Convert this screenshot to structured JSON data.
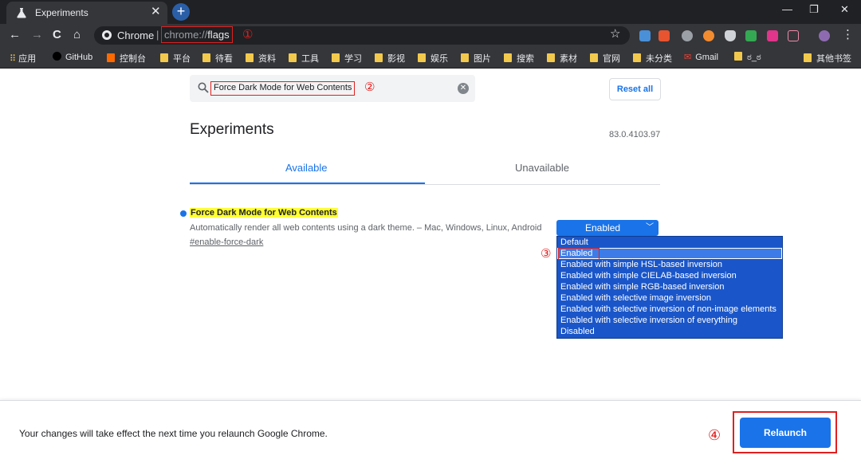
{
  "window": {
    "tab_title": "Experiments",
    "tab_close": "✕",
    "new_tab": "+",
    "controls": [
      "—",
      "❐",
      "✕"
    ]
  },
  "toolbar": {
    "back": "←",
    "forward": "→",
    "reload": "C",
    "home": "⌂",
    "site_label": "Chrome",
    "separator": "|",
    "url_scheme": "chrome://",
    "url_path": "flags",
    "annotation_1": "①",
    "bookmark_star": "☆",
    "menu": "⋮"
  },
  "bookmarks": {
    "apps": "应用",
    "items": [
      "GitHub",
      "控制台",
      "平台",
      "待看",
      "资料",
      "工具",
      "学习",
      "影视",
      "娱乐",
      "图片",
      "搜索",
      "素材",
      "官网",
      "未分类",
      "Gmail",
      "ಠ_ಠ"
    ],
    "other": "其他书签"
  },
  "search": {
    "value": "Force Dark Mode for Web Contents",
    "annotation_2": "②",
    "clear": "✕"
  },
  "reset_all": "Reset all",
  "heading": "Experiments",
  "version": "83.0.4103.97",
  "tabs": {
    "available": "Available",
    "unavailable": "Unavailable"
  },
  "experiment": {
    "title": "Force Dark Mode for Web Contents",
    "description": "Automatically render all web contents using a dark theme. – Mac, Windows, Linux, Android",
    "link": "#enable-force-dark",
    "selected": "Enabled",
    "annotation_3": "③",
    "options": [
      "Default",
      "Enabled",
      "Enabled with simple HSL-based inversion",
      "Enabled with simple CIELAB-based inversion",
      "Enabled with simple RGB-based inversion",
      "Enabled with selective image inversion",
      "Enabled with selective inversion of non-image elements",
      "Enabled with selective inversion of everything",
      "Disabled"
    ]
  },
  "footer": {
    "message": "Your changes will take effect the next time you relaunch Google Chrome.",
    "annotation_4": "④",
    "relaunch": "Relaunch"
  },
  "colors": {
    "accent": "#1a73e8",
    "annotation": "#e02020",
    "highlight": "#ffff33"
  }
}
